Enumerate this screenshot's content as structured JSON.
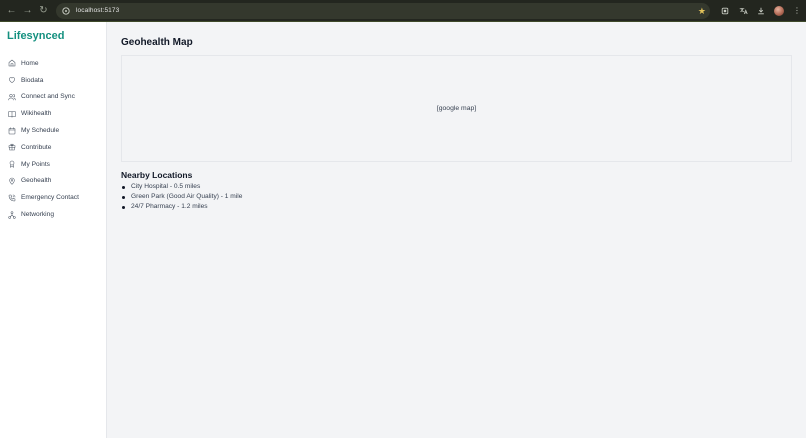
{
  "browser": {
    "url": "localhost:5173"
  },
  "sidebar": {
    "brand": "Lifesynced",
    "items": [
      {
        "label": "Home",
        "icon": "home-icon"
      },
      {
        "label": "Biodata",
        "icon": "heart-icon"
      },
      {
        "label": "Connect and Sync",
        "icon": "users-icon"
      },
      {
        "label": "Wikihealth",
        "icon": "book-icon"
      },
      {
        "label": "My Schedule",
        "icon": "calendar-icon"
      },
      {
        "label": "Contribute",
        "icon": "gift-icon"
      },
      {
        "label": "My Points",
        "icon": "award-icon"
      },
      {
        "label": "Geohealth",
        "icon": "map-pin-icon"
      },
      {
        "label": "Emergency Contact",
        "icon": "phone-icon"
      },
      {
        "label": "Networking",
        "icon": "network-icon"
      }
    ]
  },
  "main": {
    "title": "Geohealth Map",
    "map_placeholder": "[google map]",
    "nearby": {
      "title": "Nearby Locations",
      "items": [
        "City Hospital - 0.5 miles",
        "Green Park (Good Air Quality) - 1 mile",
        "24/7 Pharmacy - 1.2 miles"
      ]
    }
  },
  "colors": {
    "brand": "#14907f",
    "chrome_bg": "#23261f",
    "page_bg": "#f3f4f6"
  }
}
